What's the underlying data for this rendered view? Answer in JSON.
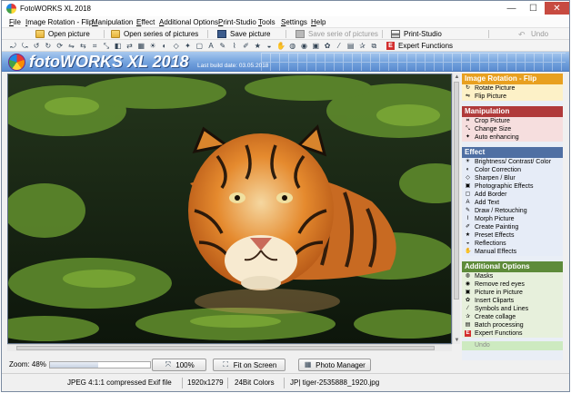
{
  "window": {
    "title": "FotoWORKS XL 2018",
    "controls": {
      "minimize": "—",
      "maximize": "☐",
      "close": "✕"
    }
  },
  "menu": [
    "File",
    "Image Rotation - Flip",
    "Manipulation",
    "Effect",
    "Additional Options",
    "Print-Studio",
    "Tools",
    "Settings",
    "Help"
  ],
  "toolbar": {
    "open_picture": "Open picture",
    "open_series": "Open series of pictures",
    "save_picture": "Save picture",
    "save_series": "Save serie of pictures",
    "print_studio": "Print-Studio",
    "undo": "Undo"
  },
  "effects_toolbar": {
    "icons": [
      "rotate-left-icon",
      "rotate-right-icon",
      "rotate-ccw-icon",
      "rotate-cw-icon",
      "refresh-icon",
      "flip-icon",
      "mirror-icon",
      "crop-icon",
      "resize-icon",
      "fill-icon",
      "swap-icon",
      "grid-icon",
      "adjust-icon",
      "contrast-icon",
      "sharpen-icon",
      "photo-effect-icon",
      "border-icon",
      "text-icon",
      "draw-icon",
      "morph-icon",
      "paint-icon",
      "preset-icon",
      "reflect-icon",
      "manual-icon",
      "mask-icon",
      "eye-icon",
      "pip-icon",
      "clipart-icon",
      "symbols-icon",
      "collage-icon",
      "star-icon",
      "batch-icon"
    ],
    "expert_label": "Expert Functions",
    "expert_glyph": "E"
  },
  "banner": {
    "logo": "fotoWORKS XL 2018",
    "build": "Last build date: 03.05.2018"
  },
  "side_panel": {
    "sections": [
      {
        "key": "rot",
        "title": "Image Rotation - Flip",
        "color": "#e8a020",
        "items": [
          {
            "label": "Rotate Picture",
            "icon": "rotate-icon"
          },
          {
            "label": "Flip Picture",
            "icon": "flip-icon"
          }
        ]
      },
      {
        "key": "man",
        "title": "Manipulation",
        "color": "#b03a3a",
        "items": [
          {
            "label": "Crop Picture",
            "icon": "crop-icon"
          },
          {
            "label": "Change Size",
            "icon": "resize-icon"
          },
          {
            "label": "Auto enhancing",
            "icon": "enhance-icon"
          }
        ]
      },
      {
        "key": "eff",
        "title": "Effect",
        "color": "#4f6fa3",
        "items": [
          {
            "label": "Brightness/ Contrast/ Color",
            "icon": "brightness-icon"
          },
          {
            "label": "Color Correction",
            "icon": "color-icon"
          },
          {
            "label": "Sharpen / Blur",
            "icon": "sharpen-icon"
          },
          {
            "label": "Photographic Effects",
            "icon": "photo-effect-icon"
          },
          {
            "label": "Add Border",
            "icon": "border-icon"
          },
          {
            "label": "Add Text",
            "icon": "text-icon"
          },
          {
            "label": "Draw / Retouching",
            "icon": "draw-icon"
          },
          {
            "label": "Morph Picture",
            "icon": "morph-icon"
          },
          {
            "label": "Create Painting",
            "icon": "paint-icon"
          },
          {
            "label": "Preset Effects",
            "icon": "preset-icon"
          },
          {
            "label": "Reflections",
            "icon": "reflect-icon"
          },
          {
            "label": "Manual Effects",
            "icon": "manual-icon"
          }
        ]
      },
      {
        "key": "add",
        "title": "Additional Options",
        "color": "#5e8b3a",
        "items": [
          {
            "label": "Masks",
            "icon": "mask-icon"
          },
          {
            "label": "Remove red eyes",
            "icon": "eye-icon"
          },
          {
            "label": "Picture in Picture",
            "icon": "pip-icon"
          },
          {
            "label": "Insert Cliparts",
            "icon": "clipart-icon"
          },
          {
            "label": "Symbols and Lines",
            "icon": "symbols-icon"
          },
          {
            "label": "Create collage",
            "icon": "collage-icon"
          },
          {
            "label": "Batch processing",
            "icon": "batch-icon"
          },
          {
            "label": "Expert Functions",
            "icon": "expert-icon"
          }
        ]
      }
    ],
    "undo": "Undo"
  },
  "zoom": {
    "label": "Zoom: 48%",
    "value": 48,
    "btn_100": "100%",
    "btn_fit": "Fit on Screen",
    "btn_manager": "Photo Manager"
  },
  "status": {
    "format": "JPEG 4:1:1 compressed Exif file",
    "size": "1920x1279",
    "colors": "24Bit Colors",
    "file": "JP| tiger-2535888_1920.jpg"
  }
}
